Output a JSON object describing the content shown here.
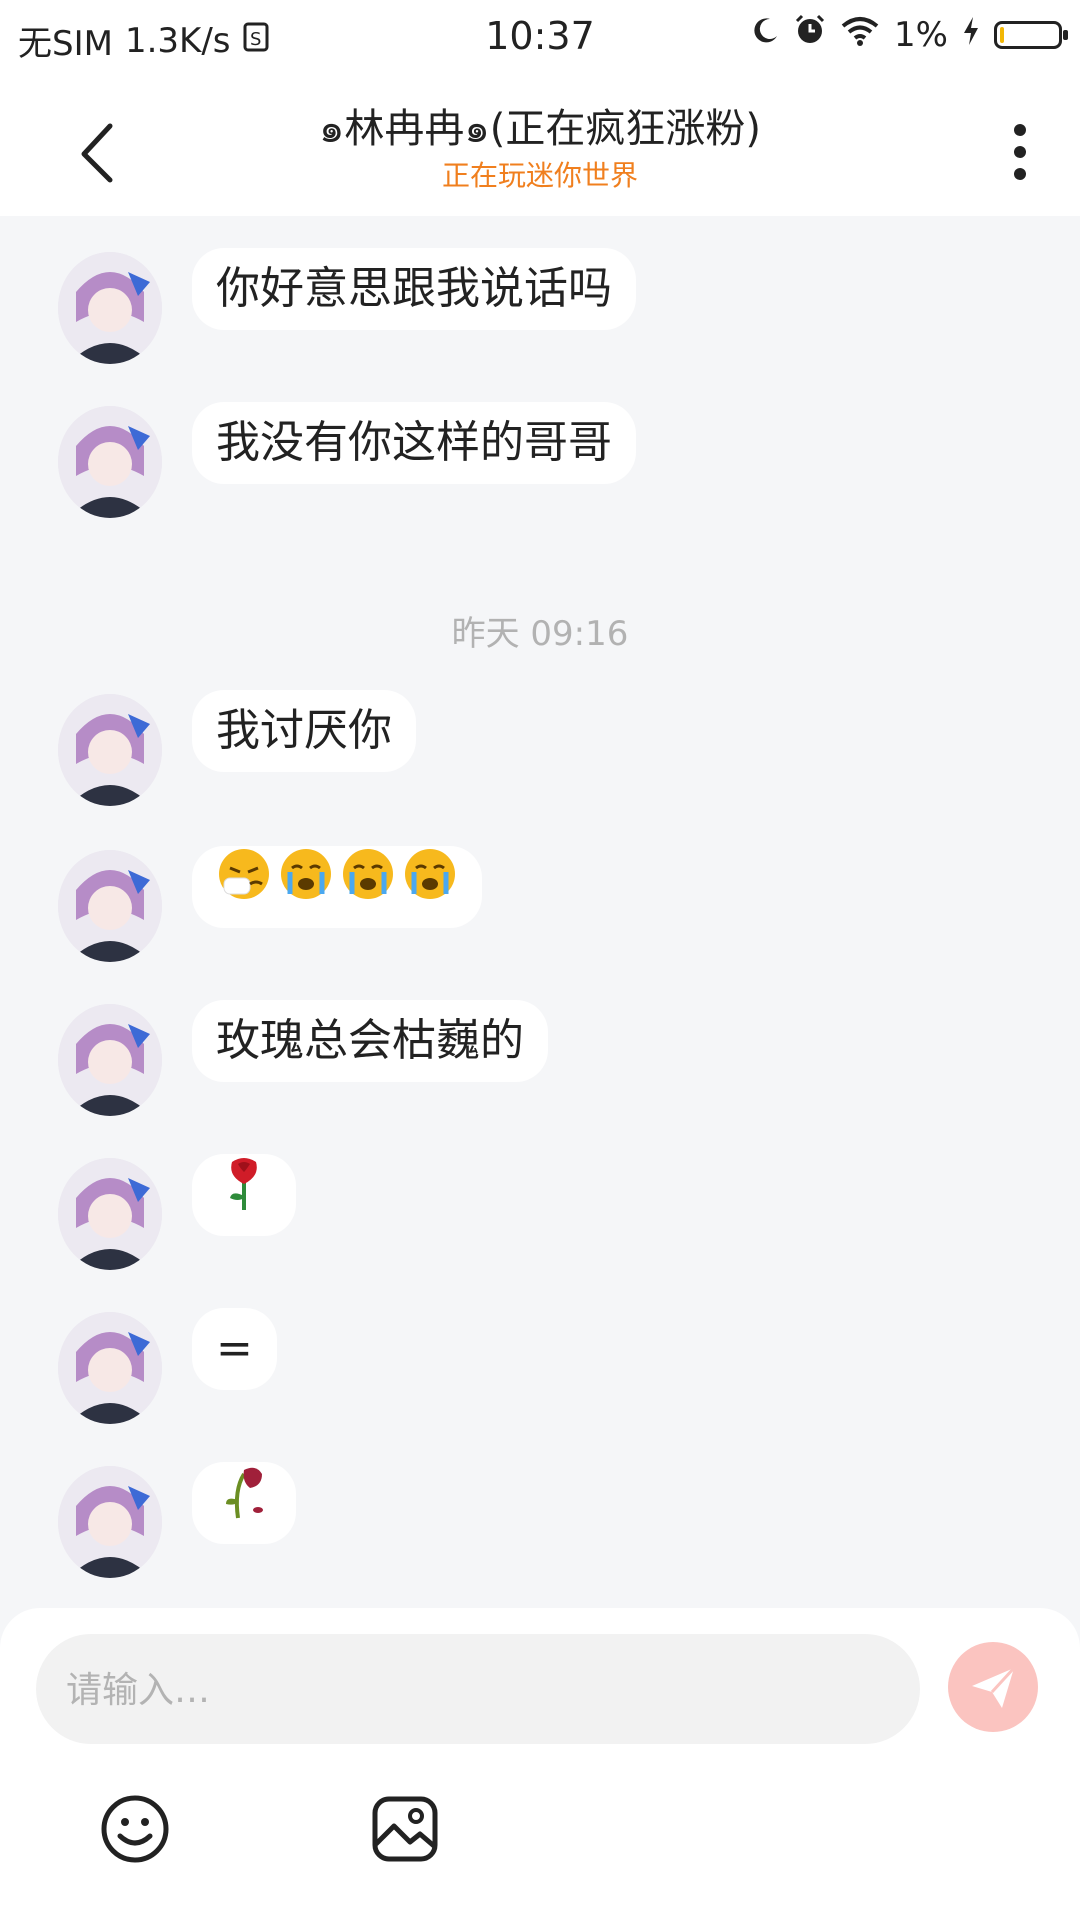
{
  "status_bar": {
    "carrier": "无SIM",
    "net_speed": "1.3K/s",
    "time": "10:37",
    "battery_percent": "1%",
    "battery_level": 0.01,
    "icons": [
      "sim-icon",
      "moon-icon",
      "alarm-icon",
      "wifi-icon",
      "charging-icon",
      "battery-icon"
    ]
  },
  "header": {
    "title": "๑林冉冉๑(正在疯狂涨粉)",
    "subtitle": "正在玩迷你世界",
    "subtitle_color": "#f07f1e"
  },
  "messages": [
    {
      "type": "text",
      "text": "你好意思跟我说话吗"
    },
    {
      "type": "text",
      "text": "我没有你这样的哥哥"
    },
    {
      "type": "timestamp",
      "text": "昨天 09:16"
    },
    {
      "type": "text",
      "text": "我讨厌你"
    },
    {
      "type": "emoji",
      "items": [
        "sneezing-face-emoji",
        "crying-face-emoji",
        "crying-face-emoji",
        "crying-face-emoji"
      ]
    },
    {
      "type": "text",
      "text": "玫瑰总会枯巍的"
    },
    {
      "type": "emoji",
      "items": [
        "rose-emoji"
      ]
    },
    {
      "type": "text",
      "text": "="
    },
    {
      "type": "emoji",
      "items": [
        "wilted-rose-emoji"
      ]
    }
  ],
  "input": {
    "placeholder": "请输入…",
    "value": ""
  },
  "colors": {
    "send_button": "#fbc4c0",
    "background": "#f5f6f8"
  }
}
